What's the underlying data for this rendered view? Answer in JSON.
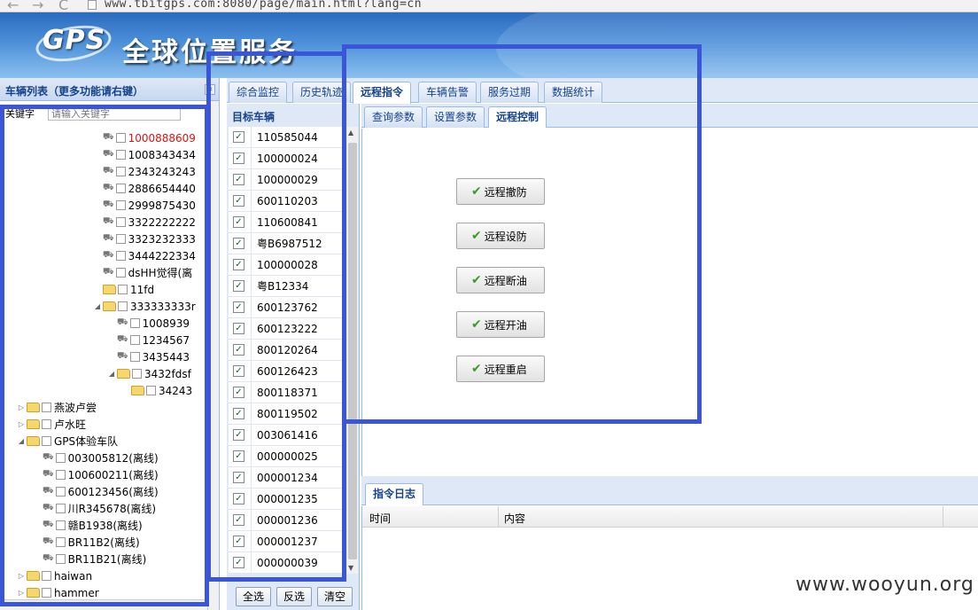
{
  "browser": {
    "url": "www.tbitgps.com:8080/page/main.html?lang=cn"
  },
  "header": {
    "logo_text": "GPS",
    "title": "全球位置服务"
  },
  "left_panel": {
    "title": "车辆列表（更多功能请右键）",
    "keyword_label": "关键字",
    "keyword_placeholder": "请输入关键字",
    "tree": [
      {
        "label": "1000888609",
        "type": "vehicle",
        "depth": 5,
        "status": "red"
      },
      {
        "label": "1008343434",
        "type": "vehicle",
        "depth": 5
      },
      {
        "label": "2343243243",
        "type": "vehicle",
        "depth": 5
      },
      {
        "label": "2886654440",
        "type": "vehicle",
        "depth": 5
      },
      {
        "label": "2999875430",
        "type": "vehicle",
        "depth": 5
      },
      {
        "label": "3322222222",
        "type": "vehicle",
        "depth": 5
      },
      {
        "label": "3323232333",
        "type": "vehicle",
        "depth": 5
      },
      {
        "label": "3444222334",
        "type": "vehicle",
        "depth": 5
      },
      {
        "label": "dsHH觉得(离",
        "type": "vehicle",
        "depth": 5
      },
      {
        "label": "11fd",
        "type": "folder",
        "depth": 5
      },
      {
        "label": "333333333r",
        "type": "folder",
        "depth": 5,
        "expanded": true
      },
      {
        "label": "1008939",
        "type": "vehicle",
        "depth": 6
      },
      {
        "label": "1234567",
        "type": "vehicle",
        "depth": 6
      },
      {
        "label": "3435443",
        "type": "vehicle",
        "depth": 6
      },
      {
        "label": "3432fdsf",
        "type": "folder",
        "depth": 6,
        "expanded": true
      },
      {
        "label": "34243",
        "type": "folder",
        "depth": 7
      },
      {
        "label": "燕波卢尝",
        "type": "folder",
        "depth": 1,
        "collapsed": true
      },
      {
        "label": "卢水旺",
        "type": "folder",
        "depth": 1,
        "collapsed": true
      },
      {
        "label": "GPS体验车队",
        "type": "folder",
        "depth": 1,
        "expanded": true
      },
      {
        "label": "003005812(离线)",
        "type": "vehicle",
        "depth": 2
      },
      {
        "label": "100600211(离线)",
        "type": "vehicle",
        "depth": 2
      },
      {
        "label": "600123456(离线)",
        "type": "vehicle",
        "depth": 2
      },
      {
        "label": "川R345678(离线)",
        "type": "vehicle",
        "depth": 2
      },
      {
        "label": "赣B1938(离线)",
        "type": "vehicle",
        "depth": 2
      },
      {
        "label": "BR11B2(离线)",
        "type": "vehicle",
        "depth": 2
      },
      {
        "label": "BR11B21(离线)",
        "type": "vehicle",
        "depth": 2
      },
      {
        "label": "haiwan",
        "type": "folder",
        "depth": 1,
        "collapsed": true
      },
      {
        "label": "hammer",
        "type": "folder",
        "depth": 1,
        "collapsed": true
      }
    ]
  },
  "main_tabs": [
    "综合监控",
    "历史轨迹",
    "远程指令",
    "车辆告警",
    "服务过期",
    "数据统计"
  ],
  "main_tab_active": "远程指令",
  "target": {
    "title": "目标车辆",
    "vehicles": [
      "110585044",
      "100000024",
      "100000029",
      "600110203",
      "110600841",
      "粤B6987512",
      "100000028",
      "粤B12334",
      "600123762",
      "600123222",
      "800120264",
      "600126423",
      "800118371",
      "800119502",
      "003061416",
      "000000025",
      "000001234",
      "000001235",
      "000001236",
      "000001237",
      "000000039"
    ],
    "checked_mark": "✓",
    "btn_select_all": "全选",
    "btn_invert": "反选",
    "btn_clear": "清空"
  },
  "sub_tabs": [
    "查询参数",
    "设置参数",
    "远程控制"
  ],
  "sub_tab_active": "远程控制",
  "remote_buttons": [
    "远程撤防",
    "远程设防",
    "远程断油",
    "远程开油",
    "远程重启"
  ],
  "log": {
    "tab": "指令日志",
    "col_time": "时间",
    "col_content": "内容"
  },
  "watermark": "www.wooyun.org",
  "colors": {
    "highlight": "#3b55d9",
    "panel_bg": "#dfe8f6",
    "header_text": "#15428b",
    "alert": "#e01010"
  }
}
